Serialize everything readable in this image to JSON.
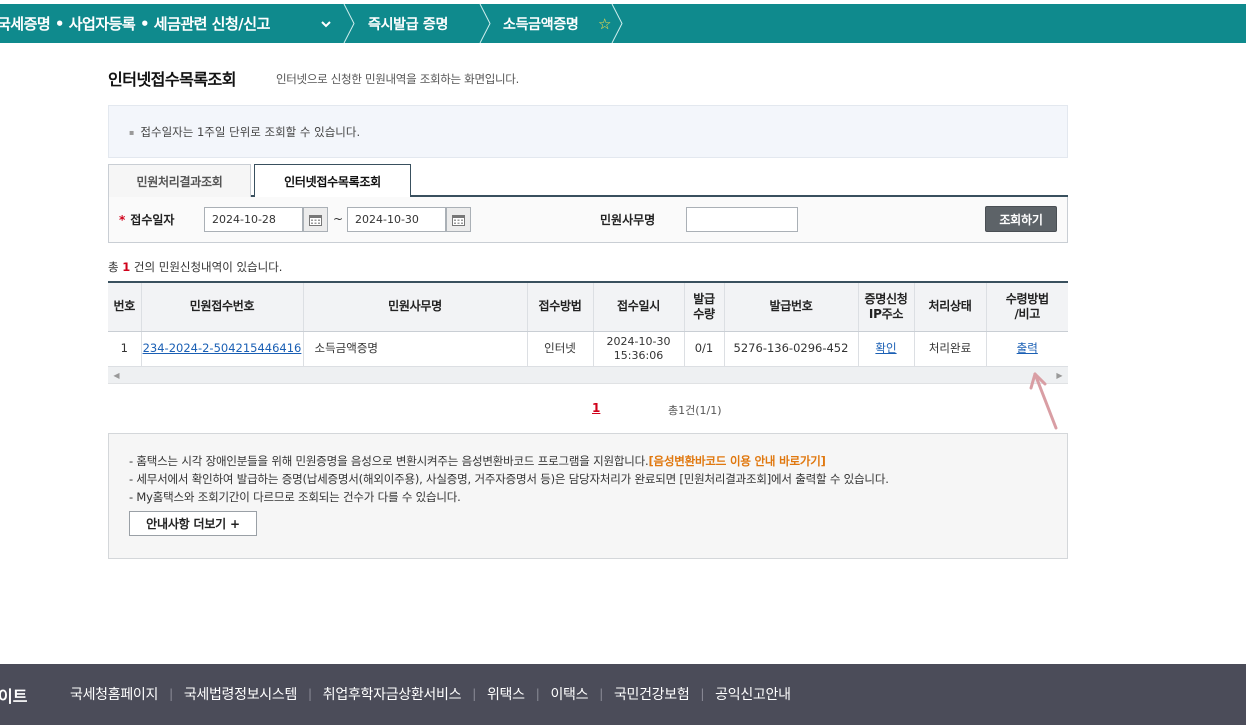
{
  "topnav": {
    "menu1": "국세증명 • 사업자등록 • 세금관련 신청/신고",
    "menu2": "즉시발급 증명",
    "menu3": "소득금액증명"
  },
  "page": {
    "title": "인터넷접수목록조회",
    "desc": "인터넷으로 신청한 민원내역을 조회하는 화면입니다."
  },
  "info": {
    "text": "접수일자는 1주일 단위로 조회할 수 있습니다."
  },
  "tabs": [
    {
      "label": "민원처리결과조회"
    },
    {
      "label": "인터넷접수목록조회"
    }
  ],
  "search": {
    "date_label": "접수일자",
    "date_from": "2024-10-28",
    "date_to": "2024-10-30",
    "tilde": "~",
    "name_label": "민원사무명",
    "name_value": "",
    "button": "조회하기"
  },
  "count": {
    "prefix": "총 ",
    "num": "1",
    "suffix": " 건의 민원신청내역이 있습니다."
  },
  "table": {
    "headers": [
      "번호",
      "민원접수번호",
      "민원사무명",
      "접수방법",
      "접수일시",
      "발급\n수량",
      "발급번호",
      "증명신청\nIP주소",
      "처리상태",
      "수령방법\n/비고"
    ],
    "rows": [
      {
        "no": "1",
        "receipt_no": "234-2024-2-504215446416",
        "service": "소득금액증명",
        "method": "인터넷",
        "date": "2024-10-30",
        "time": "15:36:06",
        "qty": "0/1",
        "issue_no": "5276-136-0296-452",
        "ip": "확인",
        "status": "처리완료",
        "receive": "출력"
      }
    ]
  },
  "pager": {
    "current": "1",
    "total": "총1건(1/1)"
  },
  "notice": {
    "line1": "- 홈택스는 시각 장애인분들을 위해 민원증명을 음성으로 변환시켜주는 음성변환바코드 프로그램을 지원합니다.",
    "line1_link": "[음성변환바코드 이용 안내 바로가기]",
    "line2": "- 세무서에서 확인하여 발급하는 증명(납세증명서(해외이주용), 사실증명, 거주자증명서 등)은 담당자처리가 완료되면 [민원처리결과조회]에서 출력할 수 있습니다.",
    "line3": "- My홈택스와 조회기간이 다르므로 조회되는 건수가 다를 수 있습니다.",
    "more": "안내사항 더보기 +"
  },
  "footer": {
    "brand": "이트",
    "links": [
      "국세청홈페이지",
      "국세법령정보시스템",
      "취업후학자금상환서비스",
      "위택스",
      "이택스",
      "국민건강보험",
      "공익신고안내"
    ]
  },
  "colors": {
    "nav_bg": "#0f8a8d",
    "footer_bg": "#4b4c59",
    "accent_red": "#d0021b",
    "link_blue": "#1a5fb4",
    "notice_orange": "#e0780f"
  }
}
